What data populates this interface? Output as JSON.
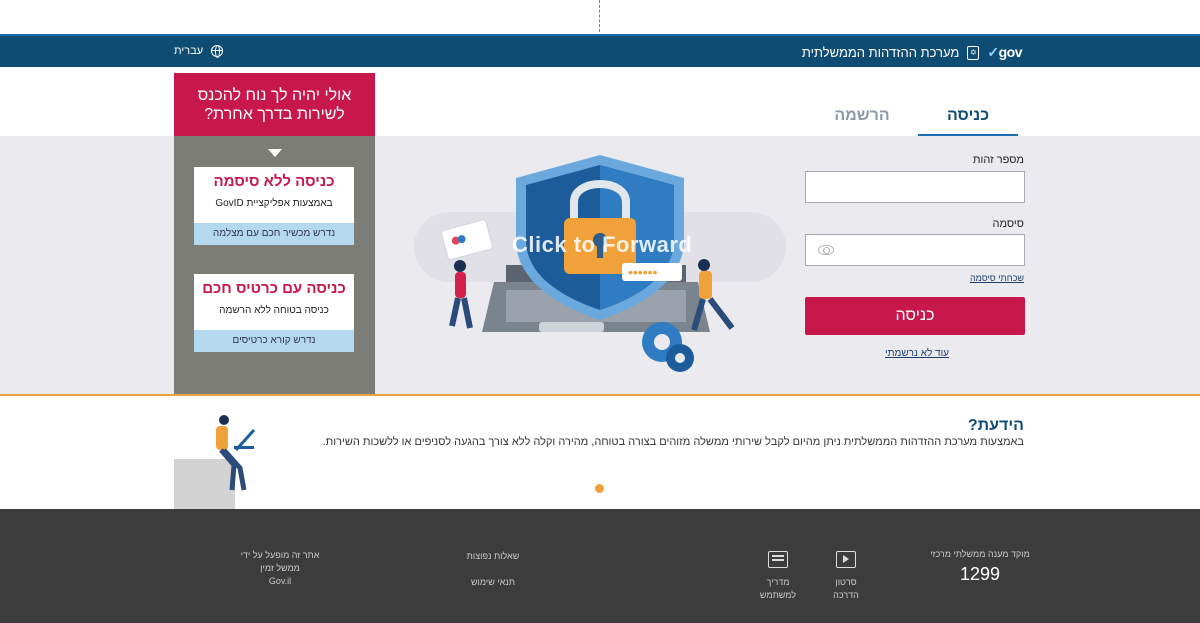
{
  "header": {
    "logo_text": "gov",
    "title": "מערכת ההזדהות הממשלתית",
    "language": "עברית"
  },
  "tabs": {
    "login": "כניסה",
    "register": "הרשמה"
  },
  "form": {
    "id_label": "מספר זהות",
    "id_value": "",
    "password_label": "סיסמה",
    "password_value": "",
    "forgot_password": "שכחתי סיסמה",
    "login_button": "כניסה",
    "not_registered": "עוד לא נרשמתי"
  },
  "alt_panel": {
    "title": "אולי יהיה לך נוח להכנס לשירות בדרך אחרת?",
    "cards": [
      {
        "title": "כניסה ללא סיסמה",
        "subtitle": "באמצעות אפליקציית GovID",
        "requirement": "נדרש מכשיר חכם עם מצלמה"
      },
      {
        "title": "כניסה עם כרטיס חכם",
        "subtitle": "כניסה בטוחה ללא הרשמה",
        "requirement": "נדרש קורא כרטיסים"
      }
    ]
  },
  "illustration": {
    "overlay_text": "Click to Forward"
  },
  "did_you_know": {
    "title": "הידעת?",
    "text": "באמצעות מערכת ההזדהות הממשלתית ניתן מהיום לקבל שירותי ממשלה מזוהים בצורה בטוחה, מהירה וקלה ללא צורך בהגעה לסניפים או ללשכות השירות."
  },
  "footer": {
    "hotline_label": "מוקד מענה ממשלתי מרכזי",
    "hotline_number": "1299",
    "video_label_1": "סרטון",
    "video_label_2": "הדרכה",
    "guide_label_1": "מדריך",
    "guide_label_2": "למשתמש",
    "faq": "שאלות נפוצות",
    "terms": "תנאי שימוש",
    "operated_1": "אתר זה מופעל על ידי",
    "operated_2": "ממשל זמין",
    "operated_3": "Gov.il"
  },
  "colors": {
    "header_bg": "#0f4c73",
    "accent": "#c8174a",
    "orange": "#f1a13a",
    "footer_bg": "#3c3c3c"
  }
}
